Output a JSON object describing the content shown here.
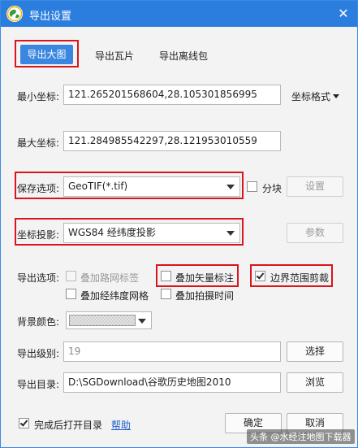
{
  "window": {
    "title": "导出设置",
    "close_glyph": "✕"
  },
  "tabs": [
    {
      "label": "导出大图",
      "active": true
    },
    {
      "label": "导出瓦片",
      "active": false
    },
    {
      "label": "导出离线包",
      "active": false
    }
  ],
  "min_coord": {
    "label": "最小坐标:",
    "value": "121.265201568604,28.105301856995"
  },
  "coord_format": {
    "label": "坐标格式"
  },
  "max_coord": {
    "label": "最大坐标:",
    "value": "121.284985542297,28.121953010559"
  },
  "save_option": {
    "label": "保存选项:",
    "value": "GeoTIF(*.tif)",
    "split_label": "分块",
    "split_checked": false,
    "settings_button": "设置"
  },
  "projection": {
    "label": "坐标投影:",
    "value": "WGS84 经纬度投影",
    "params_button": "参数"
  },
  "export_options": {
    "label": "导出选项:",
    "items": [
      {
        "label": "叠加路网标签",
        "checked": false,
        "enabled": false
      },
      {
        "label": "叠加矢量标注",
        "checked": false,
        "enabled": true
      },
      {
        "label": "边界范围剪裁",
        "checked": true,
        "enabled": true
      },
      {
        "label": "叠加经纬度网格",
        "checked": false,
        "enabled": true
      },
      {
        "label": "叠加拍摄时间",
        "checked": false,
        "enabled": true
      }
    ]
  },
  "background_color": {
    "label": "背景颜色:"
  },
  "export_level": {
    "label": "导出级别:",
    "value": "19",
    "select_button": "选择"
  },
  "export_dir": {
    "label": "导出目录:",
    "value": "D:\\SGDownload\\谷歌历史地图2010",
    "browse_button": "浏览"
  },
  "footer": {
    "open_after_label": "完成后打开目录",
    "open_after_checked": true,
    "help_link": "帮助",
    "ok_button": "确定",
    "cancel_button": "取消"
  },
  "watermark": "头条 @水经注地图下载器",
  "colors": {
    "titlebar": "#2b7ede",
    "active_tab": "#3a86e0",
    "highlight": "#d9141b",
    "link": "#1a5fc8"
  }
}
